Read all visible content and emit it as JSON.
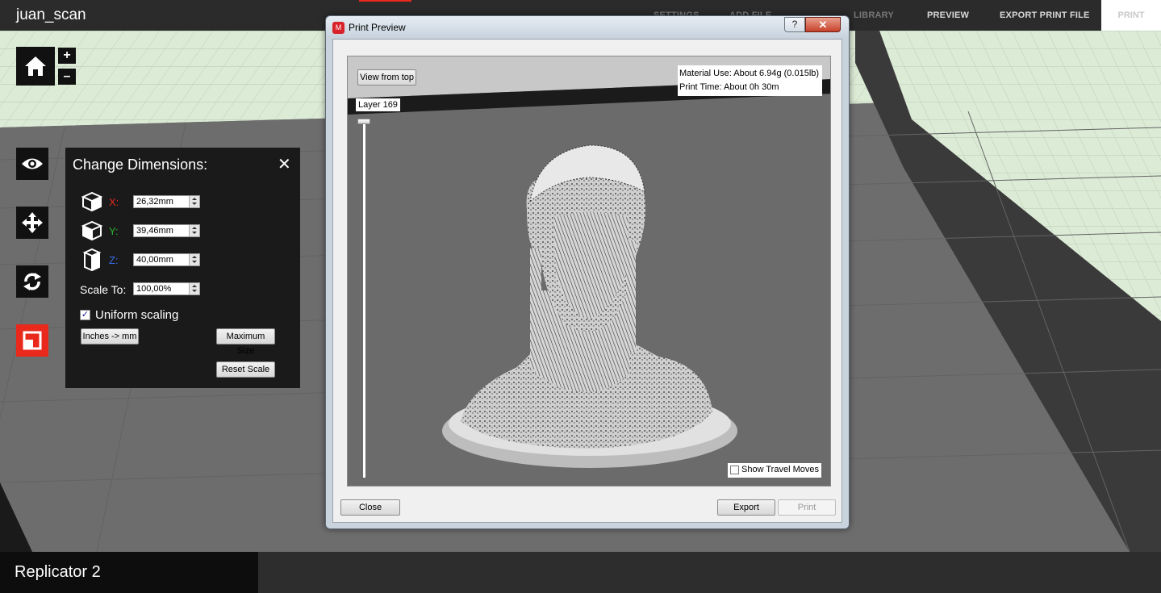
{
  "app": {
    "title": "juan_scan"
  },
  "nav": {
    "settings": "SETTINGS",
    "add_file": "ADD FILE",
    "library": "LIBRARY",
    "preview": "PREVIEW",
    "export": "EXPORT PRINT FILE",
    "print": "PRINT"
  },
  "tools": {
    "zoom_in": "+",
    "zoom_out": "–"
  },
  "dimensions": {
    "title": "Change Dimensions:",
    "close": "✕",
    "x_label": "X:",
    "x_value": "26,32mm",
    "y_label": "Y:",
    "y_value": "39,46mm",
    "z_label": "Z:",
    "z_value": "40,00mm",
    "scale_label": "Scale To:",
    "scale_value": "100,00%",
    "uniform_label": "Uniform scaling",
    "uniform_checked": "✓",
    "inches_button": "Inches -> mm",
    "max_button": "Maximum Size",
    "reset_button": "Reset Scale",
    "colors": {
      "x": "#e8291c",
      "y": "#2fb52f",
      "z": "#3a6df0"
    }
  },
  "dialog": {
    "title": "Print Preview",
    "icon": "makerbot-icon",
    "help": "?",
    "close": "✕",
    "view_top_button": "View from top",
    "layer_label": "Layer 169",
    "material_use": "Material Use: About 6.94g (0.015lb)",
    "print_time": "Print Time: About 0h 30m",
    "travel_moves": "Show Travel Moves",
    "close_button": "Close",
    "export_button": "Export",
    "print_button": "Print"
  },
  "bottom": {
    "machine": "Replicator 2"
  },
  "colors": {
    "accent": "#e8291c",
    "grid": "#dcebd6"
  }
}
